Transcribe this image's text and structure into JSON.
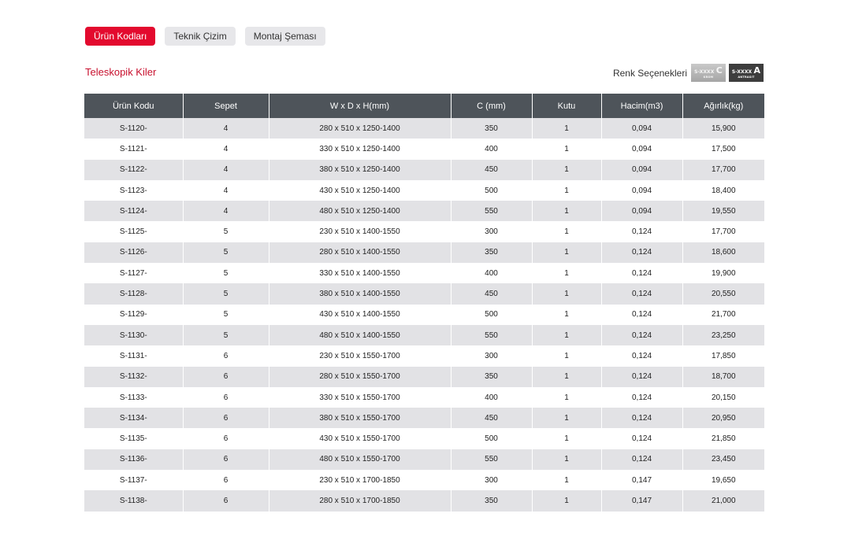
{
  "tabs": [
    {
      "label": "Ürün Kodları",
      "active": true
    },
    {
      "label": "Teknik Çizim",
      "active": false
    },
    {
      "label": "Montaj Şeması",
      "active": false
    }
  ],
  "section_title": "Teleskopik Kiler",
  "color_options": {
    "label": "Renk Seçenekleri",
    "swatches": [
      {
        "code_prefix": "S-XXXX",
        "letter": "C",
        "name": "KROM",
        "color": "#b5b5b5"
      },
      {
        "code_prefix": "S-XXXX",
        "letter": "A",
        "name": "ANTRASIT",
        "color": "#3d3d3d"
      }
    ]
  },
  "table": {
    "headers": [
      "Ürün Kodu",
      "Sepet",
      "W x D x H(mm)",
      "C (mm)",
      "Kutu",
      "Hacim(m3)",
      "Ağırlık(kg)"
    ],
    "rows": [
      [
        "S-1120-",
        "4",
        "280 x 510 x 1250-1400",
        "350",
        "1",
        "0,094",
        "15,900"
      ],
      [
        "S-1121-",
        "4",
        "330 x 510 x 1250-1400",
        "400",
        "1",
        "0,094",
        "17,500"
      ],
      [
        "S-1122-",
        "4",
        "380 x 510 x 1250-1400",
        "450",
        "1",
        "0,094",
        "17,700"
      ],
      [
        "S-1123-",
        "4",
        "430 x 510 x 1250-1400",
        "500",
        "1",
        "0,094",
        "18,400"
      ],
      [
        "S-1124-",
        "4",
        "480 x 510 x 1250-1400",
        "550",
        "1",
        "0,094",
        "19,550"
      ],
      [
        "S-1125-",
        "5",
        "230 x 510 x 1400-1550",
        "300",
        "1",
        "0,124",
        "17,700"
      ],
      [
        "S-1126-",
        "5",
        "280 x 510 x 1400-1550",
        "350",
        "1",
        "0,124",
        "18,600"
      ],
      [
        "S-1127-",
        "5",
        "330 x 510 x 1400-1550",
        "400",
        "1",
        "0,124",
        "19,900"
      ],
      [
        "S-1128-",
        "5",
        "380 x 510 x 1400-1550",
        "450",
        "1",
        "0,124",
        "20,550"
      ],
      [
        "S-1129-",
        "5",
        "430 x 510 x 1400-1550",
        "500",
        "1",
        "0,124",
        "21,700"
      ],
      [
        "S-1130-",
        "5",
        "480 x 510 x 1400-1550",
        "550",
        "1",
        "0,124",
        "23,250"
      ],
      [
        "S-1131-",
        "6",
        "230 x 510 x 1550-1700",
        "300",
        "1",
        "0,124",
        "17,850"
      ],
      [
        "S-1132-",
        "6",
        "280 x 510 x 1550-1700",
        "350",
        "1",
        "0,124",
        "18,700"
      ],
      [
        "S-1133-",
        "6",
        "330 x 510 x 1550-1700",
        "400",
        "1",
        "0,124",
        "20,150"
      ],
      [
        "S-1134-",
        "6",
        "380 x 510 x 1550-1700",
        "450",
        "1",
        "0,124",
        "20,950"
      ],
      [
        "S-1135-",
        "6",
        "430 x 510 x 1550-1700",
        "500",
        "1",
        "0,124",
        "21,850"
      ],
      [
        "S-1136-",
        "6",
        "480 x 510 x 1550-1700",
        "550",
        "1",
        "0,124",
        "23,450"
      ],
      [
        "S-1137-",
        "6",
        "230 x 510 x 1700-1850",
        "300",
        "1",
        "0,147",
        "19,650"
      ],
      [
        "S-1138-",
        "6",
        "280 x 510 x 1700-1850",
        "350",
        "1",
        "0,147",
        "21,000"
      ]
    ]
  },
  "colors": {
    "accent": "#e30a2e",
    "title": "#c8102e",
    "header_bg": "#4e545a",
    "row_stripe": "#e2e2e5"
  }
}
